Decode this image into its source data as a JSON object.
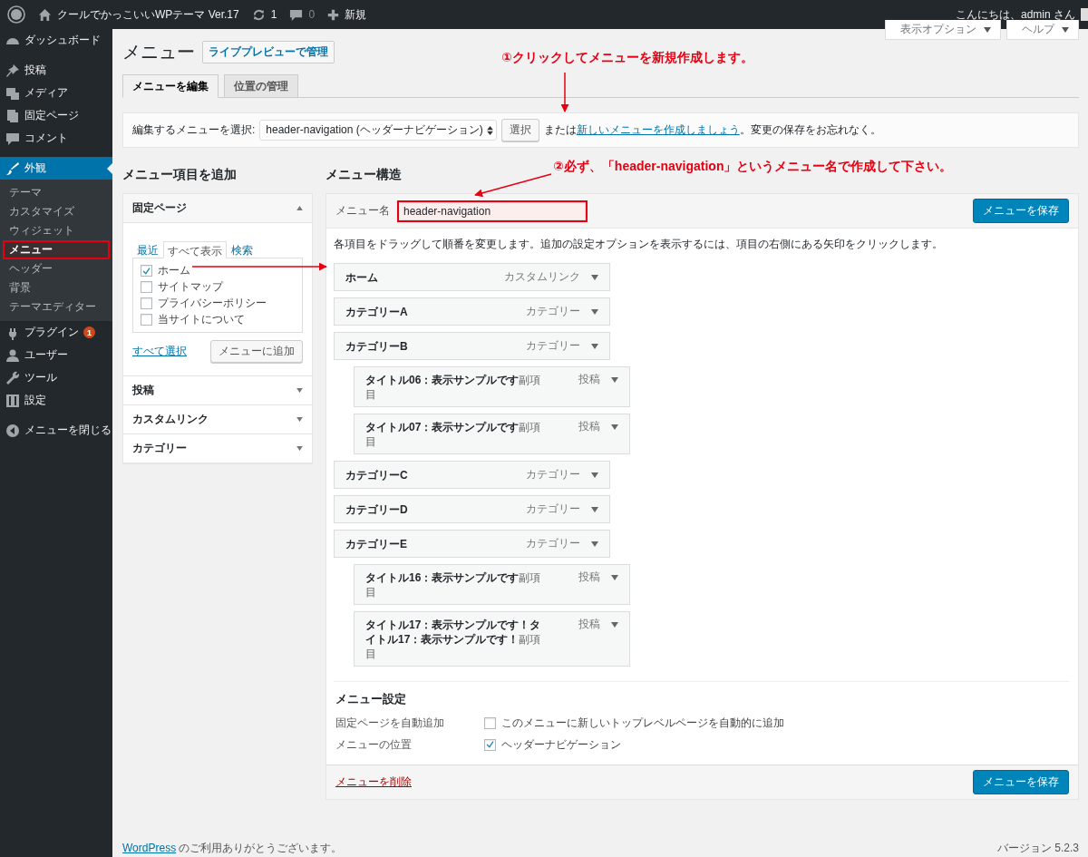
{
  "admin_bar": {
    "site_title": "クールでかっこいいWPテーマ Ver.17",
    "updates": "1",
    "comments": "0",
    "new_label": "新規",
    "greeting": "こんにちは、admin さん"
  },
  "sidebar": {
    "groups": [
      {
        "items": [
          {
            "label": "ダッシュボード",
            "selected": false
          }
        ]
      },
      {
        "items": [
          {
            "label": "投稿",
            "selected": false
          },
          {
            "label": "メディア",
            "selected": false
          },
          {
            "label": "固定ページ",
            "selected": false
          },
          {
            "label": "コメント",
            "selected": false
          }
        ]
      },
      {
        "items": [
          {
            "label": "外観",
            "selected": true,
            "children": [
              {
                "label": "テーマ",
                "selected": false,
                "highlighted": false
              },
              {
                "label": "カスタマイズ",
                "selected": false,
                "highlighted": false
              },
              {
                "label": "ウィジェット",
                "selected": false,
                "highlighted": false
              },
              {
                "label": "メニュー",
                "selected": true,
                "highlighted": true
              },
              {
                "label": "ヘッダー",
                "selected": false,
                "highlighted": false
              },
              {
                "label": "背景",
                "selected": false,
                "highlighted": false
              },
              {
                "label": "テーマエディター",
                "selected": false,
                "highlighted": false
              }
            ]
          },
          {
            "label": "プラグイン",
            "selected": false,
            "badge": "1"
          },
          {
            "label": "ユーザー",
            "selected": false
          },
          {
            "label": "ツール",
            "selected": false
          },
          {
            "label": "設定",
            "selected": false
          }
        ]
      }
    ],
    "collapse": "メニューを閉じる"
  },
  "screen_meta": [
    "表示オプション",
    "ヘルプ"
  ],
  "page": {
    "title": "メニュー",
    "preview_button": "ライブプレビューで管理",
    "tabs": [
      {
        "label": "メニューを編集",
        "selected": true
      },
      {
        "label": "位置の管理",
        "selected": false
      }
    ],
    "select_bar": {
      "label": "編集するメニューを選択:",
      "value": "header-navigation (ヘッダーナビゲーション)",
      "button": "選択",
      "note_before": "または",
      "link": "新しいメニューを作成しましょう",
      "note_after": "。変更の保存をお忘れなく。"
    }
  },
  "add_items": {
    "heading": "メニュー項目を追加",
    "sections": [
      {
        "title": "固定ページ",
        "expanded": true,
        "tabs": [
          {
            "label": "最近",
            "selected": false
          },
          {
            "label": "すべて表示",
            "selected": true
          },
          {
            "label": "検索",
            "selected": false
          }
        ],
        "pages": [
          {
            "label": "ホーム",
            "checked": true
          },
          {
            "label": "サイトマップ",
            "checked": false
          },
          {
            "label": "プライバシーポリシー",
            "checked": false
          },
          {
            "label": "当サイトについて",
            "checked": false
          }
        ],
        "select_all": "すべて選択",
        "add_button": "メニューに追加"
      },
      {
        "title": "投稿",
        "expanded": false
      },
      {
        "title": "カスタムリンク",
        "expanded": false
      },
      {
        "title": "カテゴリー",
        "expanded": false
      }
    ]
  },
  "structure": {
    "heading": "メニュー構造",
    "name_label": "メニュー名",
    "name_value": "header-navigation",
    "name_highlighted": true,
    "save_button": "メニューを保存",
    "instructions": "各項目をドラッグして順番を変更します。追加の設定オプションを表示するには、項目の右側にある矢印をクリックします。",
    "items": [
      {
        "title": "ホーム",
        "type": "カスタムリンク"
      },
      {
        "title": "カテゴリーA",
        "type": "カテゴリー"
      },
      {
        "title": "カテゴリーB",
        "type": "カテゴリー",
        "children": [
          {
            "title": "タイトル06：表示サンプルです",
            "sub_label": "副項目",
            "type": "投稿"
          },
          {
            "title": "タイトル07：表示サンプルです",
            "sub_label": "副項目",
            "type": "投稿"
          }
        ]
      },
      {
        "title": "カテゴリーC",
        "type": "カテゴリー"
      },
      {
        "title": "カテゴリーD",
        "type": "カテゴリー"
      },
      {
        "title": "カテゴリーE",
        "type": "カテゴリー",
        "children": [
          {
            "title": "タイトル16：表示サンプルです",
            "sub_label": "副項目",
            "type": "投稿"
          },
          {
            "title": "タイトル17：表示サンプルです！タイトル17：表示サンプルです！",
            "sub_label": "副項目",
            "type": "投稿"
          }
        ]
      }
    ],
    "settings": {
      "heading": "メニュー設定",
      "rows": [
        {
          "label": "固定ページを自動追加",
          "option": "このメニューに新しいトップレベルページを自動的に追加",
          "checked": false
        },
        {
          "label": "メニューの位置",
          "option": "ヘッダーナビゲーション",
          "checked": true
        }
      ]
    },
    "delete_link": "メニューを削除",
    "save_button_bottom": "メニューを保存"
  },
  "footer": {
    "link": "WordPress",
    "text": " のご利用ありがとうございます。",
    "version": "バージョン 5.2.3"
  },
  "annotations": [
    "①クリックしてメニューを新規作成します。",
    "②必ず、「header-navigation」というメニュー名で作成して下さい。"
  ]
}
